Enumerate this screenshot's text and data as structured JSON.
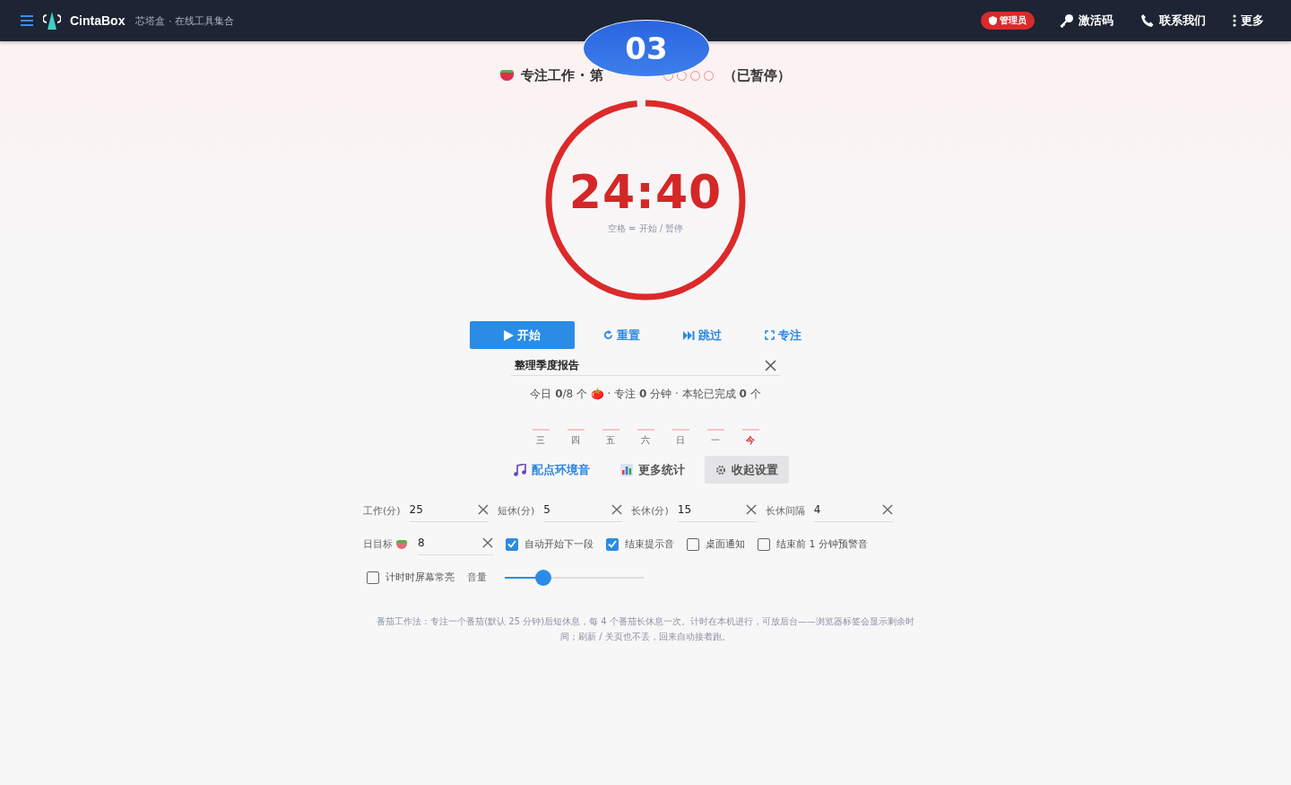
{
  "navbar": {
    "brand": "CintaBox",
    "subtitle": "芯塔盒 · 在线工具集合",
    "admin_badge": "管理员",
    "links": [
      {
        "kind": "key",
        "label": "激活码"
      },
      {
        "kind": "phone",
        "label": "联系我们"
      },
      {
        "kind": "more",
        "label": "更多"
      }
    ]
  },
  "overlay_badge": "03",
  "session": {
    "title": "专注工作 · 第",
    "rounds": [
      {
        "done": false
      },
      {
        "done": false
      },
      {
        "done": false
      },
      {
        "done": false
      }
    ],
    "status": "（已暂停）"
  },
  "timer": {
    "time": "24:40",
    "hint": "空格 = 开始 / 暂停",
    "level": 0.985
  },
  "controls": [
    {
      "kind": "play",
      "label": "开始",
      "primary": true
    },
    {
      "kind": "reset",
      "label": "重置",
      "primary": false
    },
    {
      "kind": "skip",
      "label": "跳过",
      "primary": false
    },
    {
      "kind": "focus",
      "label": "专注",
      "primary": false
    }
  ],
  "task": {
    "value": "整理季度报告"
  },
  "summary": "今日 **0**/8 个 🍅 · 专注 **0** 分钟 · 本轮已完成 **0** 个",
  "week": [
    {
      "label": "三",
      "today": false
    },
    {
      "label": "四",
      "today": false
    },
    {
      "label": "五",
      "today": false
    },
    {
      "label": "六",
      "today": false
    },
    {
      "label": "日",
      "today": false
    },
    {
      "label": "一",
      "today": false
    },
    {
      "label": "今",
      "today": true
    }
  ],
  "tabs": [
    {
      "kind": "music",
      "label": "配点环境音",
      "selected": false
    },
    {
      "kind": "stats",
      "label": "更多统计",
      "selected": false
    },
    {
      "kind": "gear",
      "label": "收起设置",
      "selected": true
    }
  ],
  "settings": {
    "fields": [
      {
        "label": "工作(分)",
        "value": "25"
      },
      {
        "label": "短休(分)",
        "value": "5"
      },
      {
        "label": "长休(分)",
        "value": "15"
      },
      {
        "label": "长休间隔",
        "value": "4"
      },
      {
        "label": "日目标",
        "value": "8"
      }
    ],
    "checkboxes": [
      {
        "label": "自动开始下一段",
        "checked": true
      },
      {
        "label": "结束提示音",
        "checked": true
      },
      {
        "label": "桌面通知",
        "checked": false
      },
      {
        "label": "结束前 1 分钟预警音",
        "checked": false
      },
      {
        "label": "计时时屏幕常亮",
        "checked": false
      }
    ],
    "volume": {
      "label": "音量",
      "level": 0.28
    }
  },
  "footer_note": "番茄工作法：专注一个番茄(默认 25 分钟)后短休息，每 4 个番茄长休息一次。计时在本机进行，可放后台——浏览器标签会显示剩余时间；刷新 / 关页也不丢，回来自动接着跑。"
}
